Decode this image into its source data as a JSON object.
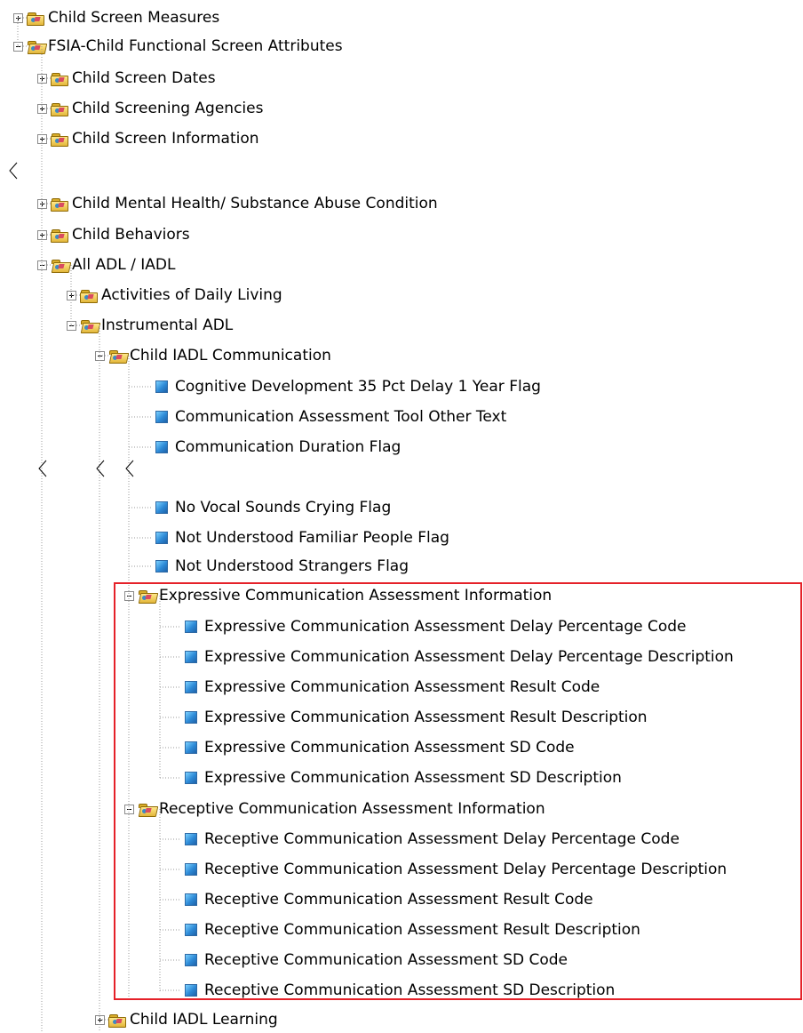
{
  "tree": {
    "items": [
      {
        "label": "Child Screen Measures",
        "type": "folder",
        "state": "collapsed"
      },
      {
        "label": "FSIA-Child Functional Screen Attributes",
        "type": "folder",
        "state": "expanded"
      },
      {
        "label": "Child Screen Dates",
        "type": "folder",
        "state": "collapsed"
      },
      {
        "label": "Child Screening Agencies",
        "type": "folder",
        "state": "collapsed"
      },
      {
        "label": "Child Screen Information",
        "type": "folder",
        "state": "collapsed"
      },
      {
        "label": "Child Mental Health/ Substance Abuse Condition",
        "type": "folder",
        "state": "collapsed"
      },
      {
        "label": "Child Behaviors",
        "type": "folder",
        "state": "collapsed"
      },
      {
        "label": "All ADL / IADL",
        "type": "folder",
        "state": "expanded"
      },
      {
        "label": "Activities of Daily Living",
        "type": "folder",
        "state": "collapsed"
      },
      {
        "label": "Instrumental ADL",
        "type": "folder",
        "state": "expanded"
      },
      {
        "label": "Child IADL Communication",
        "type": "folder",
        "state": "expanded"
      },
      {
        "label": "Cognitive Development 35 Pct Delay 1 Year Flag",
        "type": "item"
      },
      {
        "label": "Communication Assessment Tool Other Text",
        "type": "item"
      },
      {
        "label": "Communication Duration Flag",
        "type": "item"
      },
      {
        "label": "No Vocal Sounds Crying Flag",
        "type": "item"
      },
      {
        "label": "Not Understood Familiar People Flag",
        "type": "item"
      },
      {
        "label": "Not Understood Strangers Flag",
        "type": "item"
      },
      {
        "label": "Expressive Communication Assessment Information",
        "type": "folder",
        "state": "expanded"
      },
      {
        "label": "Expressive Communication Assessment Delay Percentage Code",
        "type": "item"
      },
      {
        "label": "Expressive Communication Assessment Delay Percentage Description",
        "type": "item"
      },
      {
        "label": "Expressive Communication Assessment Result Code",
        "type": "item"
      },
      {
        "label": "Expressive Communication Assessment Result Description",
        "type": "item"
      },
      {
        "label": "Expressive Communication Assessment SD Code",
        "type": "item"
      },
      {
        "label": "Expressive Communication Assessment SD Description",
        "type": "item"
      },
      {
        "label": "Receptive Communication Assessment Information",
        "type": "folder",
        "state": "expanded"
      },
      {
        "label": "Receptive Communication Assessment Delay Percentage Code",
        "type": "item"
      },
      {
        "label": "Receptive Communication Assessment Delay Percentage Description",
        "type": "item"
      },
      {
        "label": "Receptive Communication Assessment Result Code",
        "type": "item"
      },
      {
        "label": "Receptive Communication Assessment Result Description",
        "type": "item"
      },
      {
        "label": "Receptive Communication Assessment SD Code",
        "type": "item"
      },
      {
        "label": "Receptive Communication Assessment SD Description",
        "type": "item"
      },
      {
        "label": "Child IADL Learning",
        "type": "folder",
        "state": "collapsed"
      }
    ]
  },
  "colors": {
    "highlight": "#e52129",
    "folder": "#e3b73a",
    "item": "#2c89d6",
    "tree_line": "#9a9a9a"
  }
}
